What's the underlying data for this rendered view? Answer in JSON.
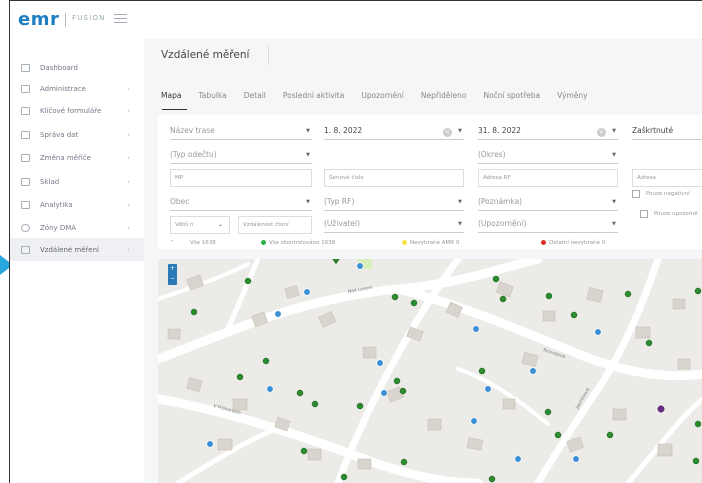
{
  "app": {
    "logo": "emr",
    "logo_sub": "FUSION"
  },
  "sidebar": {
    "items": [
      {
        "label": "Dashboard",
        "icon": "dashboard-icon",
        "chevron": ""
      },
      {
        "label": "Administrace",
        "icon": "admin-icon",
        "chevron": "›"
      },
      {
        "label": "Klíčové formuláře",
        "icon": "form-icon",
        "chevron": "›"
      },
      {
        "label": "Správa dat",
        "icon": "data-icon",
        "chevron": "›"
      },
      {
        "label": "Změna měřiče",
        "icon": "meter-change-icon",
        "chevron": "›"
      },
      {
        "label": "Sklad",
        "icon": "warehouse-icon",
        "chevron": "›"
      },
      {
        "label": "Analytika",
        "icon": "analytics-icon",
        "chevron": "›"
      },
      {
        "label": "Zóny DMA",
        "icon": "zones-icon",
        "chevron": "›"
      },
      {
        "label": "Vzdálené měření",
        "icon": "remote-meter-icon",
        "chevron": "›"
      }
    ]
  },
  "page": {
    "title": "Vzdálené měření",
    "tabs": [
      "Mapa",
      "Tabulka",
      "Detail",
      "Poslední aktivita",
      "Upozornění",
      "Nepřiděleno",
      "Noční spotřeba",
      "Výměny"
    ]
  },
  "filters": {
    "route_name": "Název trase",
    "date_from": "1. 8. 2022",
    "date_to": "31. 8. 2022",
    "checked": "Zaškrtnuté",
    "read_type": "(Typ odečtu)",
    "district": "(Okres)",
    "mp": "MP",
    "serial": "Sériové číslo",
    "rf_address": "Adresa RF",
    "address": "Adresa",
    "only_negative": "Pouze negativní",
    "municipality": "Obec",
    "rf_type": "(Typ RF)",
    "note": "(Poznámka)",
    "only_alerts": "Pouze upozorně",
    "compare_op": "Větší n",
    "read_distance": "Vzdálenost čtení",
    "user": "(Uživatel)",
    "alert": "(Upozornění)"
  },
  "legend": {
    "all": "Vše 1638",
    "all_checked": "Vše zkontrolováno 1638",
    "new_amr": "Nevybrané AMR 0",
    "other_new": "Ostatní nevybrané 0",
    "color_ok": "#2bb24c",
    "color_amr": "#f4e542",
    "color_other": "#d93025"
  },
  "map": {
    "zoom_in": "+",
    "zoom_out": "−",
    "street_1": "Rozvojová",
    "street_2": "Nad Lesem",
    "street_3": "V Průhonech",
    "street_4": "Jasmínová"
  }
}
